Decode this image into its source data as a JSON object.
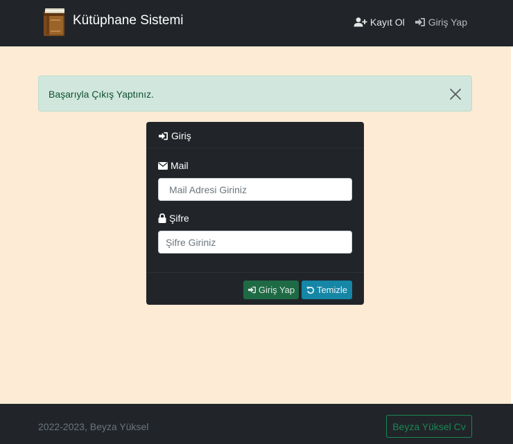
{
  "header": {
    "brand_text": "Kütüphane Sistemi",
    "logo_icon": "books-icon",
    "nav": {
      "signup_label": "Kayıt Ol",
      "signup_icon": "user-plus-icon",
      "login_label": "Giriş Yap",
      "login_icon": "sign-in-icon"
    }
  },
  "alert": {
    "message": "Başarıyla Çıkış Yaptınız.",
    "close_icon": "close-icon"
  },
  "login_card": {
    "title": "Giriş",
    "title_icon": "sign-in-icon",
    "mail": {
      "label": "Mail",
      "icon": "envelope-icon",
      "value": "",
      "placeholder": "Mail Adresi Giriniz"
    },
    "password": {
      "label": "Şifre",
      "icon": "lock-icon",
      "value": "",
      "placeholder": "Şifre Giriniz"
    },
    "buttons": {
      "submit_label": "Giriş Yap",
      "submit_icon": "sign-in-icon",
      "clear_label": "Temizle",
      "clear_icon": "undo-icon"
    }
  },
  "footer": {
    "copyright": "2022-2023, Beyza Yüksel",
    "cv_button_label": "Beyza Yüksel Cv"
  },
  "colors": {
    "navbar": "#212529",
    "page_background": "#fdebd6",
    "alert_background": "#d1e7dd",
    "alert_text": "#0f5132",
    "success_button": "#1e6a45",
    "info_button": "#1586a6",
    "footer_outline_button": "#198754"
  }
}
